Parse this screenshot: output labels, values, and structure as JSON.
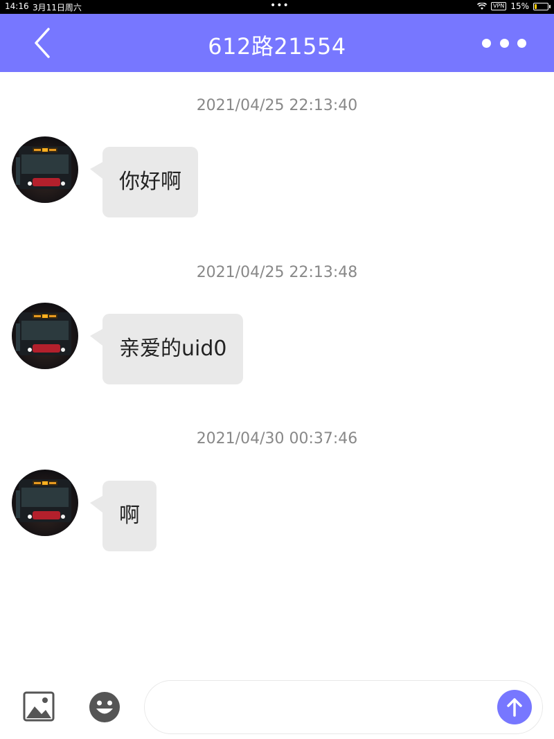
{
  "status_bar": {
    "time": "14:16",
    "date": "3月11日周六",
    "vpn_label": "VPN",
    "battery_text": "15%",
    "battery_level": 0.15
  },
  "nav": {
    "title": "612路21554",
    "back_icon": "chevron-left-icon",
    "more_icon": "more-horizontal-icon",
    "background_color": "#7777ff"
  },
  "messages": [
    {
      "timestamp": "2021/04/25 22:13:40",
      "text": "你好啊"
    },
    {
      "timestamp": "2021/04/25 22:13:48",
      "text": "亲爱的uid0"
    },
    {
      "timestamp": "2021/04/30 00:37:46",
      "text": "啊"
    }
  ],
  "input_bar": {
    "value": "",
    "image_icon": "image-icon",
    "emoji_icon": "emoji-icon",
    "send_icon": "arrow-up-icon",
    "accent_color": "#7777ff"
  }
}
